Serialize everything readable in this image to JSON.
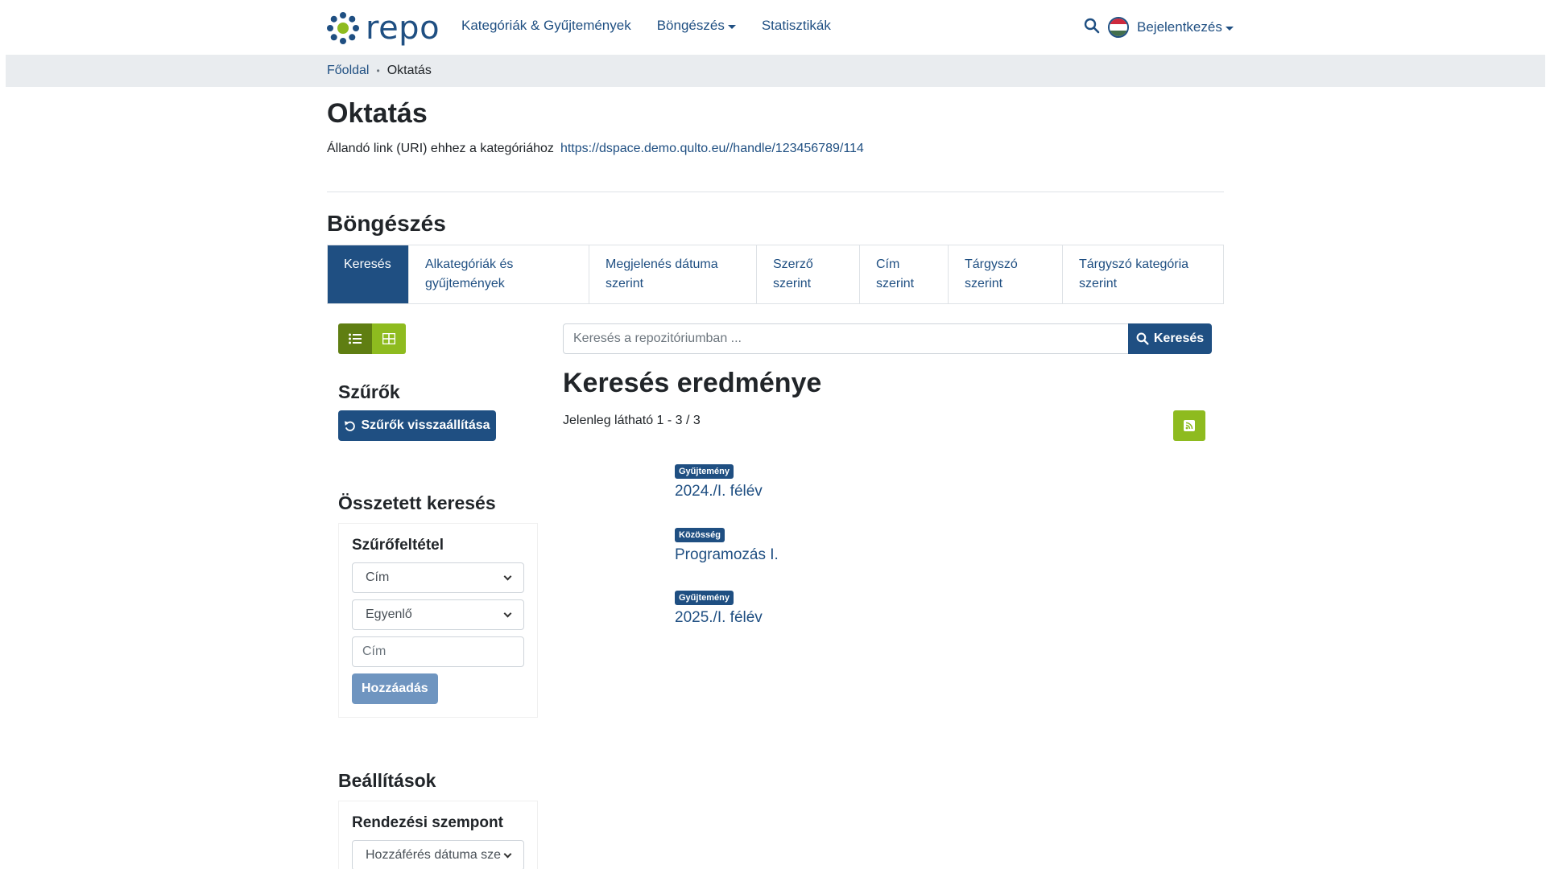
{
  "header": {
    "logo_text": "repo",
    "nav": [
      {
        "label": "Kategóriák & Gyűjtemények"
      },
      {
        "label": "Böngészés"
      },
      {
        "label": "Statisztikák"
      }
    ],
    "login_label": "Bejelentkezés"
  },
  "breadcrumb": {
    "home": "Főoldal",
    "current": "Oktatás"
  },
  "page": {
    "title": "Oktatás",
    "uri_label": "Állandó link (URI) ehhez a kategóriához",
    "uri_link": "https://dspace.demo.qulto.eu//handle/123456789/114"
  },
  "browse": {
    "title": "Böngészés",
    "tabs": [
      {
        "line1": "Keresés",
        "line2": ""
      },
      {
        "line1": "Alkategóriák és",
        "line2": "gyűjtemények"
      },
      {
        "line1": "Megjelenés dátuma",
        "line2": "szerint"
      },
      {
        "line1": "Szerző",
        "line2": "szerint"
      },
      {
        "line1": "Cím",
        "line2": "szerint"
      },
      {
        "line1": "Tárgyszó",
        "line2": "szerint"
      },
      {
        "line1": "Tárgyszó kategória",
        "line2": "szerint"
      }
    ]
  },
  "search": {
    "placeholder": "Keresés a repozitóriumban ...",
    "button": "Keresés"
  },
  "sidebar": {
    "filters_title": "Szűrők",
    "reset_button": "Szűrők visszaállítása",
    "advanced_title": "Összetett keresés",
    "filter_condition": "Szűrőfeltétel",
    "field_select": "Cím",
    "operator_select": "Egyenlő",
    "value_placeholder": "Cím",
    "add_button": "Hozzáadás",
    "settings_title": "Beállítások",
    "sort_title": "Rendezési szempont",
    "sort_select": "Hozzáférés dátuma sze"
  },
  "results": {
    "title": "Keresés eredménye",
    "count": "Jelenleg látható 1 - 3 / 3",
    "items": [
      {
        "badge": "Gyűjtemény",
        "title": "2024./I. félév"
      },
      {
        "badge": "Közösség",
        "title": "Programozás I."
      },
      {
        "badge": "Gyűjtemény",
        "title": "2025./I. félév"
      }
    ]
  },
  "colors": {
    "primary": "#1f4f82",
    "accent_green": "#8ebb1f",
    "breadcrumb_bg": "#e9ecef"
  }
}
